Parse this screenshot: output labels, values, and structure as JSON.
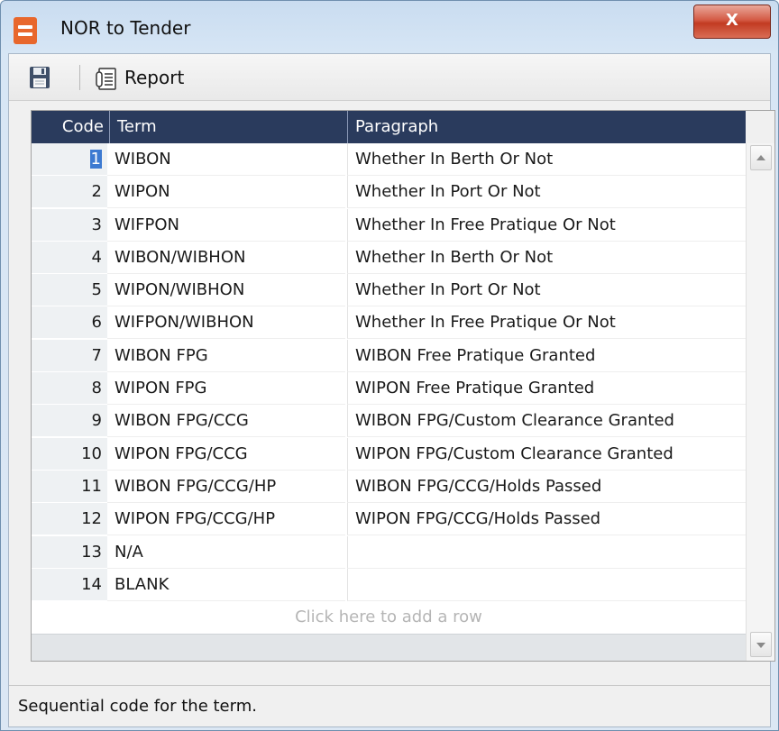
{
  "window": {
    "title": "NOR to Tender",
    "close_glyph": "X",
    "icon": "app-icon"
  },
  "toolbar": {
    "save_icon": "floppy-save-icon",
    "report_icon": "report-icon",
    "report_label": "Report"
  },
  "grid": {
    "columns": [
      "Code",
      "Term",
      "Paragraph"
    ],
    "rows": [
      {
        "code": "1",
        "term": "WIBON",
        "paragraph": "Whether In Berth Or Not"
      },
      {
        "code": "2",
        "term": "WIPON",
        "paragraph": "Whether In Port Or Not"
      },
      {
        "code": "3",
        "term": "WIFPON",
        "paragraph": "Whether In Free Pratique Or Not"
      },
      {
        "code": "4",
        "term": "WIBON/WIBHON",
        "paragraph": "Whether In Berth Or Not"
      },
      {
        "code": "5",
        "term": "WIPON/WIBHON",
        "paragraph": "Whether In Port Or Not"
      },
      {
        "code": "6",
        "term": "WIFPON/WIBHON",
        "paragraph": "Whether In Free Pratique Or Not"
      },
      {
        "code": "7",
        "term": "WIBON FPG",
        "paragraph": "WIBON Free Pratique Granted"
      },
      {
        "code": "8",
        "term": "WIPON FPG",
        "paragraph": "WIPON Free Pratique Granted"
      },
      {
        "code": "9",
        "term": "WIBON FPG/CCG",
        "paragraph": "WIBON FPG/Custom Clearance Granted"
      },
      {
        "code": "10",
        "term": "WIPON FPG/CCG",
        "paragraph": "WIPON FPG/Custom Clearance Granted"
      },
      {
        "code": "11",
        "term": "WIBON FPG/CCG/HP",
        "paragraph": "WIBON FPG/CCG/Holds Passed"
      },
      {
        "code": "12",
        "term": "WIPON FPG/CCG/HP",
        "paragraph": "WIPON FPG/CCG/Holds Passed"
      },
      {
        "code": "13",
        "term": "N/A",
        "paragraph": ""
      },
      {
        "code": "14",
        "term": "BLANK",
        "paragraph": ""
      }
    ],
    "add_row_text": "Click here to add a row"
  },
  "status": {
    "text": "Sequential code for the term."
  },
  "colors": {
    "header_bg": "#2a3b5d",
    "selection": "#3d7ad1",
    "close_button": "#c23b22",
    "app_icon": "#e8672c"
  }
}
